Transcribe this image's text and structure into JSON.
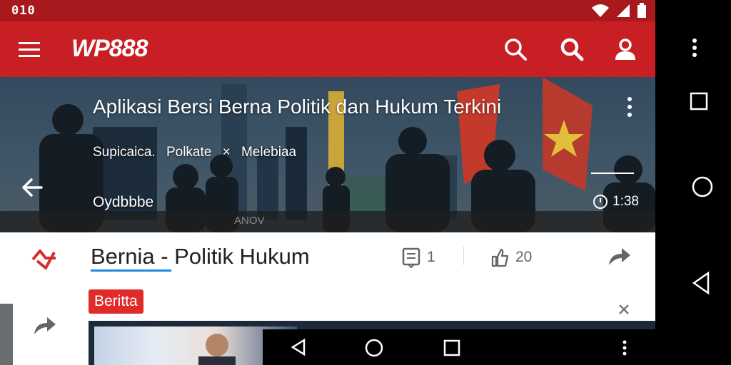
{
  "status_bar": {
    "time": "010",
    "icons": [
      "wifi-icon",
      "signal-icon",
      "battery-icon"
    ]
  },
  "app_bar": {
    "brand": "WP888",
    "icons": [
      "menu-icon",
      "search-icon",
      "search-icon",
      "account-icon"
    ],
    "color": "#c81f25"
  },
  "hero": {
    "title": "Aplikasi Bersi Berna Politik dan Hukum Terkini",
    "subtitle_items": [
      "Supicaica.",
      "Polkate",
      "×",
      "Melebiaa"
    ],
    "source": "Oydbbbe",
    "duration": "1:38",
    "bottom_text": "ANOV"
  },
  "article": {
    "title": "Bernia - Politik Hukum",
    "comments_count": "1",
    "likes_count": "20",
    "tag": "Beritta",
    "accent": "#1e88e5",
    "tag_color": "#e02b2b"
  },
  "nav": {
    "right": [
      "more-vert-icon",
      "recents-square-icon",
      "home-circle-icon",
      "back-triangle-icon"
    ],
    "bottom": [
      "back-triangle-icon",
      "home-circle-icon",
      "recents-square-icon",
      "more-vert-icon"
    ]
  }
}
